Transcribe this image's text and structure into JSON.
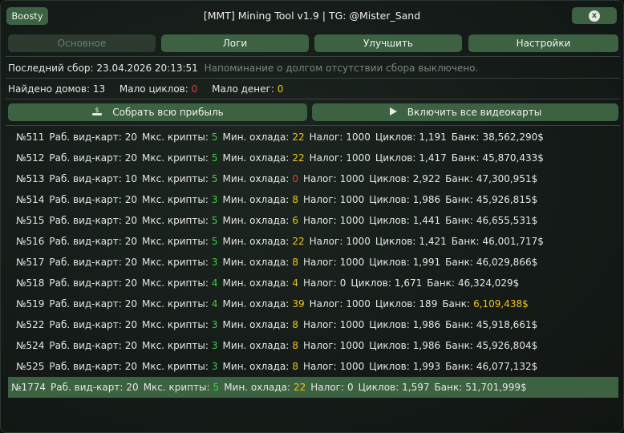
{
  "window": {
    "title": "[MMT] Mining Tool v1.9 | TG: @Mister_Sand",
    "boosty_label": "Boosty",
    "close_label": "x"
  },
  "tabs": [
    {
      "label": "Основное",
      "active": false
    },
    {
      "label": "Логи",
      "active": true
    },
    {
      "label": "Улучшить",
      "active": true
    },
    {
      "label": "Настройки",
      "active": true
    }
  ],
  "status": {
    "last_collect": "Последний сбор: 23.04.2026 20:13:51",
    "reminder": "Напоминание о долгом отсутствии сбора выключено.",
    "houses_found": "Найдено домов: 13",
    "low_cycles_label": "Мало циклов:",
    "low_cycles_value": "0",
    "low_money_label": "Мало денег:",
    "low_money_value": "0"
  },
  "actions": {
    "collect_label": "Собрать всю прибыль",
    "enable_gpus_label": "Включить все видеокарты"
  },
  "labels": {
    "gpus": "Раб. вид-карт:",
    "max_crypto": "Мкс. крипты:",
    "min_cooling": "Мин. охлада:",
    "tax": "Налог:",
    "cycles": "Циклов:",
    "bank": "Банк:"
  },
  "houses": [
    {
      "id": "№511",
      "gpus": "20",
      "crypto": "5",
      "cooling": "22",
      "cooling_color": "yellow",
      "tax": "1000",
      "cycles": "1,191",
      "bank": "38,562,290$",
      "bank_color": "",
      "selected": false
    },
    {
      "id": "№512",
      "gpus": "20",
      "crypto": "5",
      "cooling": "22",
      "cooling_color": "yellow",
      "tax": "1000",
      "cycles": "1,417",
      "bank": "45,870,433$",
      "bank_color": "",
      "selected": false
    },
    {
      "id": "№513",
      "gpus": "10",
      "crypto": "5",
      "cooling": "0",
      "cooling_color": "red",
      "tax": "1000",
      "cycles": "2,922",
      "bank": "47,300,951$",
      "bank_color": "",
      "selected": false
    },
    {
      "id": "№514",
      "gpus": "20",
      "crypto": "3",
      "cooling": "8",
      "cooling_color": "yellow",
      "tax": "1000",
      "cycles": "1,986",
      "bank": "45,926,815$",
      "bank_color": "",
      "selected": false
    },
    {
      "id": "№515",
      "gpus": "20",
      "crypto": "5",
      "cooling": "6",
      "cooling_color": "yellow",
      "tax": "1000",
      "cycles": "1,441",
      "bank": "46,655,531$",
      "bank_color": "",
      "selected": false
    },
    {
      "id": "№516",
      "gpus": "20",
      "crypto": "5",
      "cooling": "22",
      "cooling_color": "yellow",
      "tax": "1000",
      "cycles": "1,421",
      "bank": "46,001,717$",
      "bank_color": "",
      "selected": false
    },
    {
      "id": "№517",
      "gpus": "20",
      "crypto": "3",
      "cooling": "8",
      "cooling_color": "yellow",
      "tax": "1000",
      "cycles": "1,991",
      "bank": "46,029,866$",
      "bank_color": "",
      "selected": false
    },
    {
      "id": "№518",
      "gpus": "20",
      "crypto": "4",
      "cooling": "4",
      "cooling_color": "yellow",
      "tax": "0",
      "cycles": "1,671",
      "bank": "46,324,029$",
      "bank_color": "",
      "selected": false
    },
    {
      "id": "№519",
      "gpus": "20",
      "crypto": "4",
      "cooling": "39",
      "cooling_color": "yellow",
      "tax": "1000",
      "cycles": "189",
      "bank": "6,109,438$",
      "bank_color": "yellow",
      "selected": false
    },
    {
      "id": "№522",
      "gpus": "20",
      "crypto": "3",
      "cooling": "8",
      "cooling_color": "yellow",
      "tax": "1000",
      "cycles": "1,986",
      "bank": "45,918,661$",
      "bank_color": "",
      "selected": false
    },
    {
      "id": "№524",
      "gpus": "20",
      "crypto": "3",
      "cooling": "8",
      "cooling_color": "yellow",
      "tax": "1000",
      "cycles": "1,986",
      "bank": "45,926,804$",
      "bank_color": "",
      "selected": false
    },
    {
      "id": "№525",
      "gpus": "20",
      "crypto": "3",
      "cooling": "8",
      "cooling_color": "yellow",
      "tax": "1000",
      "cycles": "1,993",
      "bank": "46,077,132$",
      "bank_color": "",
      "selected": false
    },
    {
      "id": "№1774",
      "gpus": "20",
      "crypto": "5",
      "cooling": "22",
      "cooling_color": "yellow",
      "tax": "0",
      "cycles": "1,597",
      "bank": "51,701,999$",
      "bank_color": "",
      "selected": true
    }
  ],
  "colors": {
    "accent": "#3c6241",
    "yellow": "#f0c419",
    "red": "#e23b3b",
    "green": "#38d43c"
  }
}
